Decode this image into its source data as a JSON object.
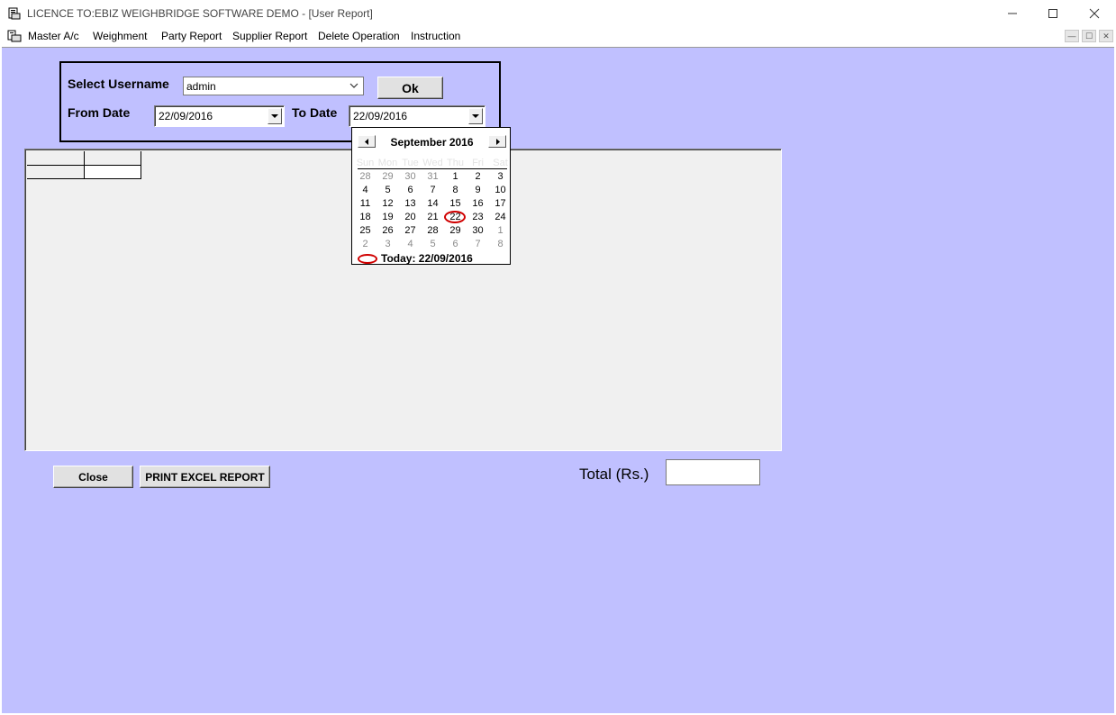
{
  "window": {
    "title": "LICENCE TO:EBIZ WEIGHBRIDGE SOFTWARE DEMO - [User Report]",
    "min_glyph": "—",
    "max_glyph": "☐",
    "close_glyph": "✕"
  },
  "menu": {
    "items": [
      "Master A/c",
      "Weighment",
      "Party Report",
      "Supplier Report",
      "Delete Operation",
      "Instruction"
    ]
  },
  "filters": {
    "username_label": "Select Username",
    "username_value": "admin",
    "ok_label": "Ok",
    "from_label": "From Date",
    "from_value": "22/09/2016",
    "to_label": "To Date",
    "to_value": "22/09/2016"
  },
  "calendar": {
    "month_label": "September 2016",
    "weekdays": [
      "Sun",
      "Mon",
      "Tue",
      "Wed",
      "Thu",
      "Fri",
      "Sat"
    ],
    "weeks": [
      [
        "28",
        "29",
        "30",
        "31",
        "1",
        "2",
        "3"
      ],
      [
        "4",
        "5",
        "6",
        "7",
        "8",
        "9",
        "10"
      ],
      [
        "11",
        "12",
        "13",
        "14",
        "15",
        "16",
        "17"
      ],
      [
        "18",
        "19",
        "20",
        "21",
        "22",
        "23",
        "24"
      ],
      [
        "25",
        "26",
        "27",
        "28",
        "29",
        "30",
        "1"
      ],
      [
        "2",
        "3",
        "4",
        "5",
        "6",
        "7",
        "8"
      ]
    ],
    "selected_day": "22",
    "today_label": "Today: 22/09/2016"
  },
  "actions": {
    "close_label": "Close",
    "print_label": "PRINT EXCEL REPORT"
  },
  "total": {
    "label": "Total (Rs.)",
    "value": ""
  },
  "colors": {
    "client_background": "#c0c0ff",
    "grid_background": "#f0f0f0",
    "selection_circle": "#d00000"
  }
}
